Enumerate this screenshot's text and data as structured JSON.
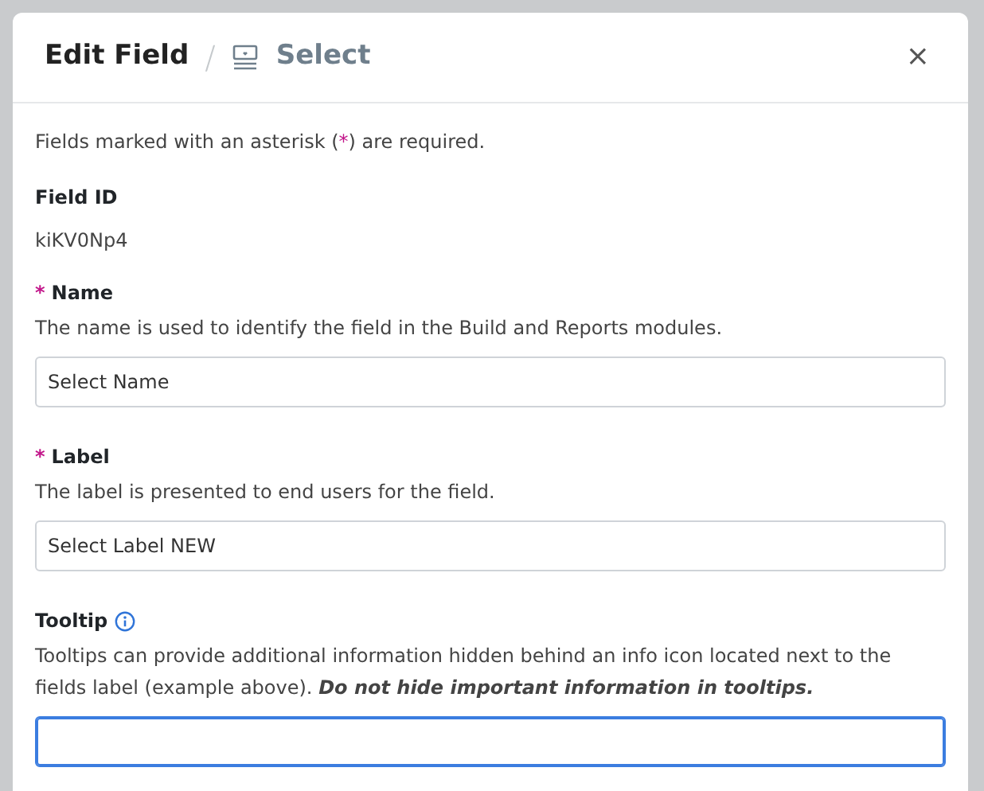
{
  "dialog": {
    "title": "Edit Field",
    "separator": "/",
    "subtitle": "Select",
    "close": "×"
  },
  "required_note": {
    "before": "Fields marked with an asterisk (",
    "mark": "*",
    "after": ") are required."
  },
  "field_id": {
    "label": "Field ID",
    "value": "kiKV0Np4"
  },
  "fields": [
    {
      "label": "Name",
      "required": true,
      "info": false,
      "help": "The name is used to identify the field in the Build and Reports modules.",
      "value": "Select Name",
      "focused": false
    },
    {
      "label": "Label",
      "required": true,
      "info": false,
      "help": "The label is presented to end users for the field.",
      "value": "Select Label NEW",
      "focused": false
    },
    {
      "label": "Tooltip",
      "required": false,
      "info": true,
      "help": "Tooltips can provide additional information hidden behind an info icon located next to the fields label (example above). *Do not hide important information in tooltips.*",
      "focused": true
    }
  ]
}
